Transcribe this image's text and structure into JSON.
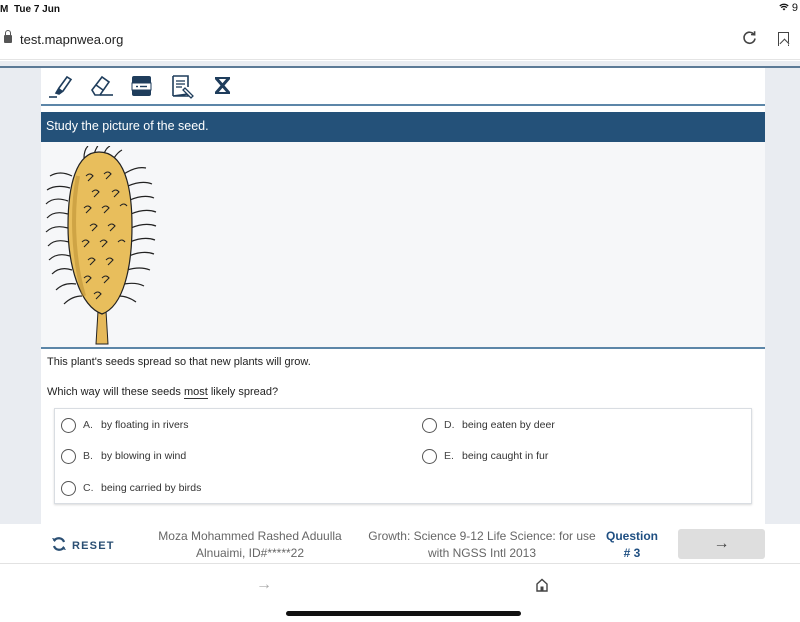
{
  "status_bar": {
    "time_fragment": "M",
    "date": "Tue 7 Jun",
    "battery_fragment": "9"
  },
  "browser": {
    "url": "test.mapnwea.org",
    "icons": [
      "lock-icon",
      "reload-icon",
      "bookmark-icon"
    ]
  },
  "toolbar": {
    "tools": [
      {
        "name": "highlighter",
        "icon": "highlighter-icon"
      },
      {
        "name": "eraser",
        "icon": "eraser-icon"
      },
      {
        "name": "answer-masking",
        "icon": "line-reader-icon"
      },
      {
        "name": "notepad",
        "icon": "notepad-icon"
      },
      {
        "name": "answer-eliminator",
        "icon": "eliminator-icon"
      }
    ]
  },
  "item": {
    "prompt": "Study the picture of the seed.",
    "figure_alt": "seed with hooked spines",
    "stem": "This plant's seeds spread so that new plants will grow.",
    "question_before": "Which way will these seeds ",
    "question_emphasis": "most",
    "question_after": " likely spread?",
    "options": [
      {
        "letter": "A.",
        "text": "by floating in rivers",
        "selected": false
      },
      {
        "letter": "B.",
        "text": "by blowing in wind",
        "selected": false
      },
      {
        "letter": "C.",
        "text": "being carried by birds",
        "selected": false
      },
      {
        "letter": "D.",
        "text": "being eaten by deer",
        "selected": false
      },
      {
        "letter": "E.",
        "text": "being caught in fur",
        "selected": false
      }
    ]
  },
  "footer": {
    "reset_label": "RESET",
    "student_line1": "Moza Mohammed Rashed Aduulla",
    "student_line2": "Alnuaimi, ID#*****22",
    "test_line1": "Growth: Science 9-12 Life Science: for use",
    "test_line2": "with NGSS Intl 2013",
    "question_label": "Question",
    "question_number": "# 3",
    "next_symbol": "→"
  },
  "browser_bottom": {
    "forward_symbol": "→"
  },
  "colors": {
    "banner": "#245179",
    "accent": "#1f4f82",
    "rule": "#5c86a8"
  }
}
